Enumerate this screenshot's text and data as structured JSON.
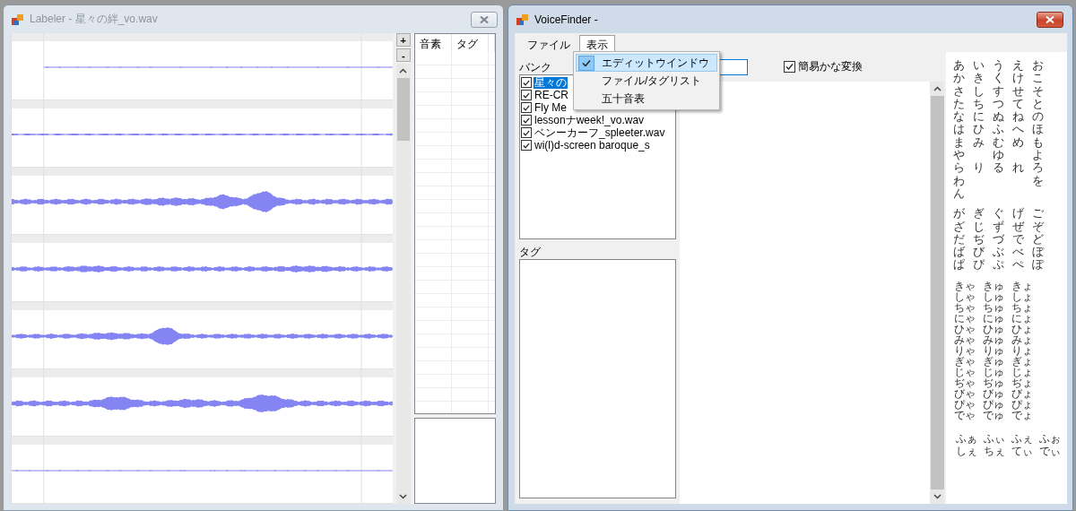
{
  "labeler": {
    "title": "Labeler - 星々の絆_vo.wav",
    "zoom_buttons": [
      "+",
      "-"
    ],
    "table": {
      "columns": [
        "音素",
        "タグ"
      ]
    }
  },
  "voicefinder": {
    "title": "VoiceFinder -",
    "menu": [
      {
        "label": "ファイル",
        "selected": false
      },
      {
        "label": "表示",
        "selected": true
      }
    ],
    "dropdown": [
      {
        "label": "エディットウインドウ",
        "checked": true,
        "selected": true
      },
      {
        "label": "ファイル/タグリスト",
        "checked": false,
        "selected": false
      },
      {
        "label": "五十音表",
        "checked": false,
        "selected": false
      }
    ],
    "bank": {
      "label": "バンク",
      "items": [
        {
          "name": "星々の",
          "checked": true,
          "selected": true
        },
        {
          "name": "RE-CR",
          "checked": true,
          "selected": false
        },
        {
          "name": "Fly Me",
          "checked": true,
          "selected": false
        },
        {
          "name": "lessonナweek!_vo.wav",
          "checked": true,
          "selected": false
        },
        {
          "name": "ベンーカーフ_spleeter.wav",
          "checked": true,
          "selected": false
        },
        {
          "name": "wi(l)d-screen baroque_s",
          "checked": true,
          "selected": false
        }
      ]
    },
    "tags": {
      "label": "タグ"
    },
    "kana_conversion": {
      "label": "簡易かな変換",
      "checked": true
    },
    "kana_table": {
      "seion_columns": [
        [
          "あかさたなはまやらわん"
        ],
        [
          "いきしちにひみ",
          "り"
        ],
        [
          "うくすつぬふむゆる"
        ],
        [
          "えけせてねへめ",
          "れ"
        ],
        [
          "おこそとのほもよろを"
        ]
      ],
      "dakuon_columns": [
        "がざだばぱ",
        "ぎじぢびぴ",
        "ぐずづぶぷ",
        "げぜでべぺ",
        "ごぞどぼぽ"
      ],
      "youon_columns": [
        "きゃしゃちゃにゃひゃみゃりゃぎゃじゃぢゃびゃぴゃでゃ",
        "きゅしゅちゅにゅひゅみゅりゅぎゅじゅぢゅびゅぴゅでゅ",
        "きょしょちょにょひょみょりょぎょじょぢょびょぴょでょ"
      ],
      "foreign_rows": [
        [
          "ふぁ",
          "ふぃ",
          "ふぇ",
          "ふぉ"
        ],
        [
          "しぇ",
          "ちぇ",
          "てぃ",
          "でぃ"
        ]
      ]
    }
  }
}
